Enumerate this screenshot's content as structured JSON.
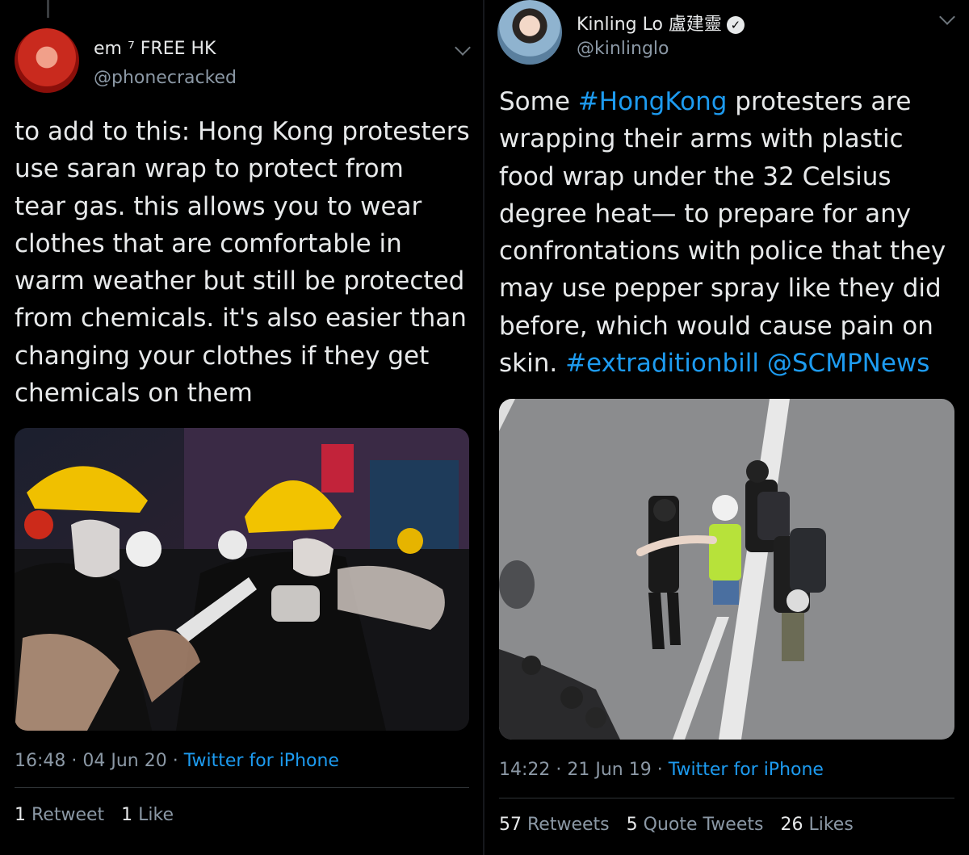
{
  "left_tweet": {
    "name": "em ⁷ FREE HK",
    "handle": "@phonecracked",
    "text_lines": [
      "to add to this: Hong Kong protesters",
      "use saran wrap to protect from",
      "tear gas. this allows you to wear",
      "clothes that are comfortable in",
      "warm weather but still be protected",
      "from chemicals. it's also easier than",
      "changing your clothes if they get",
      "chemicals on them"
    ],
    "time": "16:48 · 04 Jun 20 · ",
    "source": "Twitter for iPhone",
    "retweets_count": "1",
    "retweets_label": "Retweet",
    "likes_count": "1",
    "likes_label": "Like"
  },
  "right_tweet": {
    "name": "Kinling Lo 盧建靈",
    "handle": "@kinlinglo",
    "text_line1_pre": "Some ",
    "hashtag1": "#HongKong",
    "text_line1_post": " protesters are",
    "text_lines_mid": [
      "wrapping their arms with plastic",
      "food wrap under the 32 Celsius",
      "degree heat— to prepare for any",
      "confrontations with police that they",
      "may use pepper spray like they did",
      "before, which would cause pain on"
    ],
    "text_last_pre": "skin. ",
    "hashtag2": "#extraditionbill",
    "mention": "@SCMPNews",
    "time": "14:22 · 21 Jun 19 · ",
    "source": "Twitter for iPhone",
    "retweets_count": "57",
    "retweets_label": "Retweets",
    "quotes_count": "5",
    "quotes_label": "Quote Tweets",
    "likes_count": "26",
    "likes_label": "Likes"
  },
  "icons": {
    "verified": "verified-badge-icon",
    "chevron": "chevron-down-icon"
  },
  "colors": {
    "background": "#000000",
    "text": "#e7e9ea",
    "secondary": "#8b98a5",
    "link": "#1d9bf0"
  }
}
